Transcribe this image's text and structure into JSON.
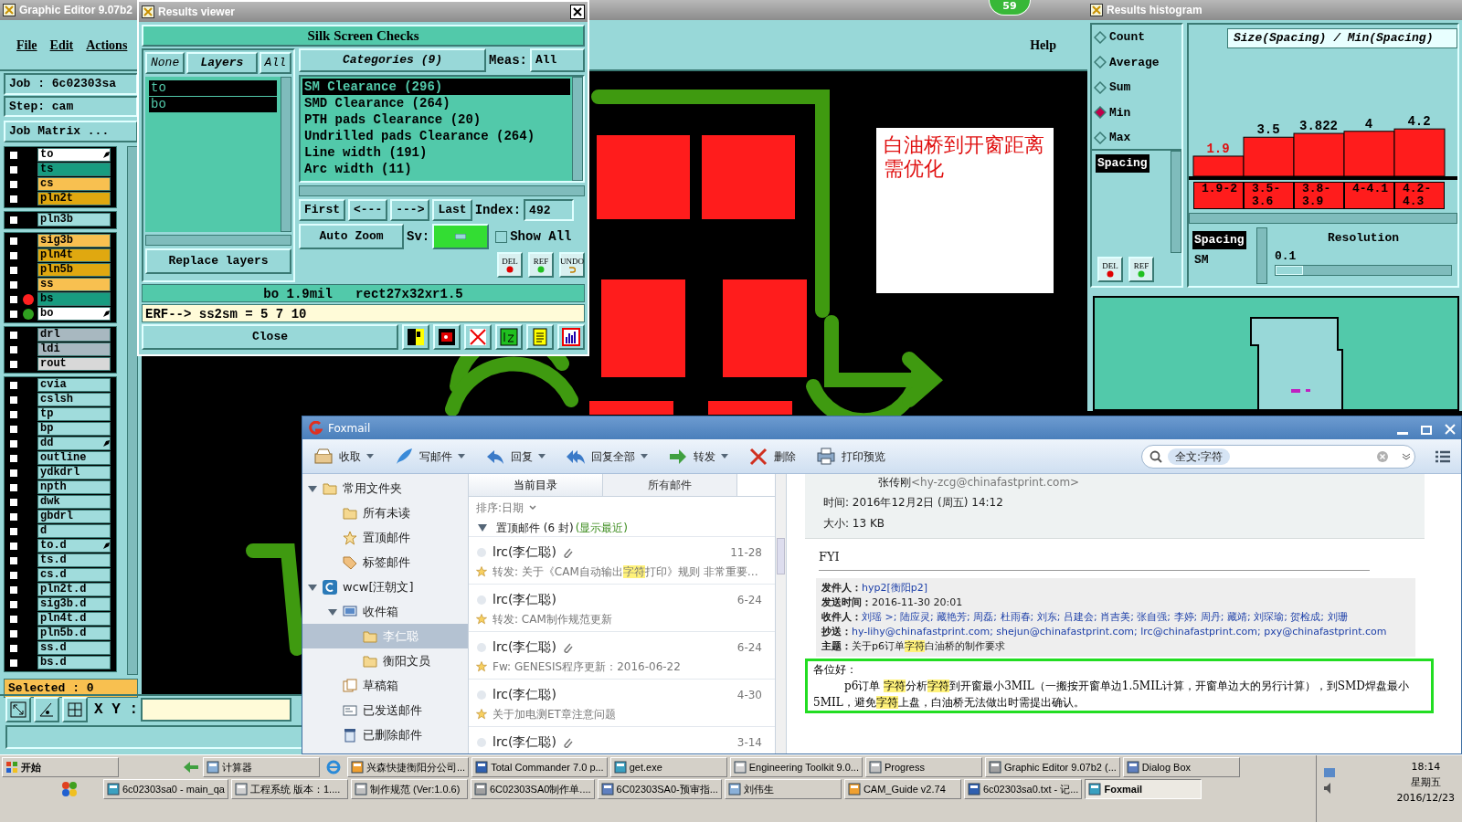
{
  "editor": {
    "title": "Graphic Editor 9.07b2",
    "menu": [
      "File",
      "Edit",
      "Actions"
    ],
    "help": "Help",
    "job": "Job : 6c02303sa",
    "step": "Step: cam",
    "job_matrix": "Job Matrix ...",
    "layer_groups": [
      [
        {
          "name": "to",
          "color": "#ffffff",
          "affected": true,
          "checked": false
        },
        {
          "name": "ts",
          "color": "#189c80",
          "affected": false,
          "checked": false
        },
        {
          "name": "cs",
          "color": "#f8c050",
          "affected": false,
          "checked": false
        },
        {
          "name": "pln2t",
          "color": "#e0a810",
          "affected": false,
          "checked": false
        }
      ],
      [
        {
          "name": "pln3b",
          "color": "#a0dcdc",
          "affected": false,
          "checked": false
        }
      ],
      [
        {
          "name": "sig3b",
          "color": "#f8c050",
          "affected": false,
          "checked": false
        },
        {
          "name": "pln4t",
          "color": "#e0a810",
          "affected": false,
          "checked": false
        },
        {
          "name": "pln5b",
          "color": "#e0a810",
          "affected": false,
          "checked": false
        },
        {
          "name": "ss",
          "color": "#f8c050",
          "affected": false,
          "checked": false
        },
        {
          "name": "bs",
          "color": "#189c80",
          "affected": false,
          "checked": false,
          "dot": {
            "color": "#ff2020"
          }
        },
        {
          "name": "bo",
          "color": "#ffffff",
          "affected": true,
          "checked": false,
          "dot": {
            "color": "#30a020"
          }
        }
      ],
      [
        {
          "name": "drl",
          "color": "#a8b8c0",
          "affected": false,
          "checked": false
        },
        {
          "name": "ldi",
          "color": "#a8b8c0",
          "affected": false,
          "checked": false
        },
        {
          "name": "rout",
          "color": "#d8d8d8",
          "affected": false,
          "checked": false
        }
      ],
      [
        {
          "name": "cvia",
          "color": "#a0dcdc",
          "affected": false,
          "checked": false
        },
        {
          "name": "cslsh",
          "color": "#a0dcdc",
          "affected": false,
          "checked": false
        },
        {
          "name": "tp",
          "color": "#a0dcdc",
          "affected": false,
          "checked": false
        },
        {
          "name": "bp",
          "color": "#a0dcdc",
          "affected": false,
          "checked": false
        },
        {
          "name": "dd",
          "color": "#a0dcdc",
          "affected": true,
          "checked": false
        },
        {
          "name": "outline",
          "color": "#a0dcdc",
          "affected": false,
          "checked": false
        },
        {
          "name": "ydkdrl",
          "color": "#a0dcdc",
          "affected": false,
          "checked": false
        },
        {
          "name": "npth",
          "color": "#a0dcdc",
          "affected": false,
          "checked": false
        },
        {
          "name": "dwk",
          "color": "#a0dcdc",
          "affected": false,
          "checked": false
        },
        {
          "name": "gbdrl",
          "color": "#a0dcdc",
          "affected": false,
          "checked": false
        },
        {
          "name": "d",
          "color": "#a0dcdc",
          "affected": false,
          "checked": false
        },
        {
          "name": "to.d",
          "color": "#a0dcdc",
          "affected": true,
          "checked": false
        },
        {
          "name": "ts.d",
          "color": "#a0dcdc",
          "affected": false,
          "checked": false
        },
        {
          "name": "cs.d",
          "color": "#a0dcdc",
          "affected": false,
          "checked": false
        },
        {
          "name": "pln2t.d",
          "color": "#a0dcdc",
          "affected": false,
          "checked": false
        },
        {
          "name": "sig3b.d",
          "color": "#a0dcdc",
          "affected": false,
          "checked": false
        },
        {
          "name": "pln4t.d",
          "color": "#a0dcdc",
          "affected": false,
          "checked": false
        },
        {
          "name": "pln5b.d",
          "color": "#a0dcdc",
          "affected": false,
          "checked": false
        },
        {
          "name": "ss.d",
          "color": "#a0dcdc",
          "affected": false,
          "checked": false
        },
        {
          "name": "bs.d",
          "color": "#a0dcdc",
          "affected": false,
          "checked": false
        }
      ]
    ],
    "selected_count": "Selected : 0",
    "xy_label": "X Y :",
    "note": "白油桥到开窗距离需优化"
  },
  "badge": "59",
  "results_viewer": {
    "title": "Results viewer",
    "heading": "Silk Screen Checks",
    "layer_buttons": [
      "None",
      "Layers",
      "All"
    ],
    "layers": [
      {
        "name": "to",
        "selected": true
      },
      {
        "name": "bo",
        "selected": true
      }
    ],
    "categories_button": "Categories (9)",
    "meas_label": "Meas:",
    "meas_value": "All",
    "categories": [
      {
        "label": "SM Clearance (296)",
        "selected": true
      },
      {
        "label": "SMD Clearance (264)",
        "selected": false
      },
      {
        "label": "PTH pads Clearance (20)",
        "selected": false
      },
      {
        "label": "Undrilled pads Clearance (264)",
        "selected": false
      },
      {
        "label": "Line width (191)",
        "selected": false
      },
      {
        "label": "Arc width (11)",
        "selected": false
      }
    ],
    "nav": [
      "First",
      "<---",
      "--->",
      "Last"
    ],
    "index_label": "Index:",
    "index_value": "492",
    "auto_zoom": "Auto Zoom",
    "sv_label": "Sv:",
    "show_all": {
      "label": "Show All",
      "checked": false
    },
    "replace": "Replace layers",
    "tools": [
      {
        "label": "DEL",
        "kind": "del"
      },
      {
        "label": "REF",
        "kind": "ref"
      },
      {
        "label": "UNDO",
        "kind": "undo"
      }
    ],
    "status": "bo 1.9mil   rect27x32xr1.5",
    "erf": "ERF--> ss2sm = 5 7 10",
    "close": "Close"
  },
  "histogram": {
    "title": "Results histogram",
    "modes": [
      {
        "label": "Count",
        "selected": false
      },
      {
        "label": "Average",
        "selected": false
      },
      {
        "label": "Sum",
        "selected": false
      },
      {
        "label": "Min",
        "selected": true
      },
      {
        "label": "Max",
        "selected": false
      }
    ],
    "attributes": [
      {
        "label": "Spacing",
        "selected": true
      }
    ],
    "buttons": [
      {
        "label": "DEL",
        "kind": "del"
      },
      {
        "label": "REF",
        "kind": "ref"
      }
    ],
    "chart_data": {
      "type": "bar",
      "title": "Size(Spacing) / Min(Spacing)",
      "categories": [
        "1.9-2",
        "3.5-3.6",
        "3.8-3.9",
        "4-4.1",
        "4.2-4.3"
      ],
      "values": [
        1.9,
        3.5,
        3.822,
        4,
        4.2
      ],
      "data_labels": true
    },
    "sub_list": [
      {
        "label": "Spacing",
        "selected": true
      },
      {
        "label": "SM",
        "selected": false
      }
    ],
    "resolution": {
      "label": "Resolution",
      "value": "0.1",
      "level": 0.0
    }
  },
  "foxmail": {
    "title": "Foxmail",
    "toolbar": [
      {
        "kind": "inbox",
        "label": "收取",
        "menu": true
      },
      {
        "kind": "compose",
        "label": "写邮件",
        "menu": true
      },
      {
        "kind": "reply",
        "label": "回复",
        "menu": true
      },
      {
        "kind": "reply_all",
        "label": "回复全部",
        "menu": true
      },
      {
        "kind": "forward",
        "label": "转发",
        "menu": true
      },
      {
        "kind": "delete",
        "label": "删除",
        "menu": false
      },
      {
        "kind": "print",
        "label": "打印预览",
        "menu": false
      }
    ],
    "search": {
      "tag": "全文:字符"
    },
    "folders": [
      {
        "label": "常用文件夹",
        "kind": "folder",
        "expanded": true,
        "selected": false,
        "children": [
          {
            "label": "所有未读",
            "kind": "folder",
            "selected": false
          },
          {
            "label": "置顶邮件",
            "kind": "star",
            "selected": false
          },
          {
            "label": "标签邮件",
            "kind": "tag",
            "selected": false
          }
        ]
      },
      {
        "label": "wcw[汪朝文]",
        "kind": "account",
        "expanded": true,
        "selected": false,
        "children": [
          {
            "label": "收件箱",
            "kind": "inbox",
            "expanded": true,
            "selected": false,
            "children": [
              {
                "label": "李仁聪",
                "kind": "folder",
                "selected": true
              },
              {
                "label": "衡阳文员",
                "kind": "folder",
                "selected": false
              }
            ]
          },
          {
            "label": "草稿箱",
            "kind": "drafts",
            "selected": false
          },
          {
            "label": "已发送邮件",
            "kind": "sent",
            "selected": false
          },
          {
            "label": "已删除邮件",
            "kind": "trash",
            "selected": false
          }
        ]
      }
    ],
    "tabs": [
      {
        "label": "当前目录",
        "selected": true
      },
      {
        "label": "所有邮件",
        "selected": false
      }
    ],
    "sort": "排序:日期",
    "group": {
      "label": "置顶邮件 (6 封)",
      "link": "(显示最近)",
      "expanded": true
    },
    "messages": [
      {
        "sender": "lrc(李仁聪)",
        "attachment": true,
        "date": "11-28",
        "subject": [
          {
            "text": "转发: 关于《CAM自动输出",
            "highlight": false
          },
          {
            "text": "字符",
            "highlight": true
          },
          {
            "text": "打印》规则 非常重要…",
            "highlight": false
          }
        ]
      },
      {
        "sender": "lrc(李仁聪)",
        "attachment": false,
        "date": "6-24",
        "subject": [
          {
            "text": "转发: CAM制作规范更新",
            "highlight": false
          }
        ]
      },
      {
        "sender": "lrc(李仁聪)",
        "attachment": true,
        "date": "6-24",
        "subject": [
          {
            "text": "Fw: GENESIS程序更新：2016-06-22",
            "highlight": false
          }
        ]
      },
      {
        "sender": "lrc(李仁聪)",
        "attachment": false,
        "date": "4-30",
        "subject": [
          {
            "text": "关于加电测ET章注意问题",
            "highlight": false
          }
        ]
      },
      {
        "sender": "lrc(李仁聪)",
        "attachment": true,
        "date": "3-14"
      }
    ],
    "reading": {
      "from_name": "张传刚",
      "from_email": "<hy-zcg@chinafastprint.com>",
      "time_label": "时间:",
      "time": "2016年12月2日 (周五) 14:12",
      "size_label": "大小:",
      "size": "13 KB",
      "fyi": "FYI",
      "quote": [
        {
          "label": "发件人：",
          "link": true,
          "segments": [
            {
              "text": "hyp2[衡阳p2]",
              "highlight": false
            }
          ]
        },
        {
          "label": "发送时间：",
          "link": false,
          "segments": [
            {
              "text": "2016-11-30 20:01",
              "highlight": false
            }
          ]
        },
        {
          "label": "收件人：",
          "link": true,
          "segments": [
            {
              "text": "刘瑶 >; 陆应灵; 藏艳芳; 周磊; 杜雨春; 刘东; 吕建会; 肖吉美; 张自强; 李婷; 周丹; 藏靖; 刘琛瑜; 贺检成; 刘珊",
              "highlight": false
            }
          ]
        },
        {
          "label": "抄送：",
          "link": true,
          "segments": [
            {
              "text": "hy-lihy@chinafastprint.com; shejun@chinafastprint.com; lrc@chinafastprint.com; pxy@chinafastprint.com",
              "highlight": false
            }
          ]
        },
        {
          "label": "主题：",
          "link": false,
          "segments": [
            {
              "text": "关于p6订单",
              "highlight": false
            },
            {
              "text": "字符",
              "highlight": true
            },
            {
              "text": "白油桥的制作要求",
              "highlight": false
            }
          ]
        }
      ],
      "greeting": "各位好：",
      "paragraph": [
        {
          "text": "p6订单 ",
          "highlight": false
        },
        {
          "text": "字符",
          "highlight": true
        },
        {
          "text": "分析",
          "highlight": false
        },
        {
          "text": "字符",
          "highlight": true
        },
        {
          "text": "到开窗最小3MIL（一搬按开窗单边1.5MIL计算，开窗单边大的另行计算），到SMD焊盘最小5MIL，避免",
          "highlight": false
        },
        {
          "text": "字符",
          "highlight": true
        },
        {
          "text": "上盘，白油桥无法做出时需提出确认。",
          "highlight": false
        }
      ]
    }
  },
  "taskbar": {
    "start": "开始",
    "row1": [
      {
        "label": "计算器",
        "selected": false
      },
      {
        "label": "兴森快捷衡阳分公司...",
        "selected": false
      },
      {
        "label": "Total Commander 7.0 p...",
        "selected": false
      },
      {
        "label": "get.exe",
        "selected": false
      },
      {
        "label": "Engineering Toolkit 9.0...",
        "selected": false
      },
      {
        "label": "Progress",
        "selected": false
      },
      {
        "label": "Graphic Editor 9.07b2 (...",
        "selected": false
      },
      {
        "label": "Dialog Box",
        "selected": false
      }
    ],
    "row2": [
      {
        "label": "6c02303sa0 - main_qa",
        "selected": false
      },
      {
        "label": "工程系统  版本：1....",
        "selected": false
      },
      {
        "label": "制作规范 (Ver:1.0.6)",
        "selected": false
      },
      {
        "label": "6C02303SA0制作单....",
        "selected": false
      },
      {
        "label": "6C02303SA0-预审指...",
        "selected": false
      },
      {
        "label": "刘伟生",
        "selected": false
      },
      {
        "label": "CAM_Guide v2.74",
        "selected": false
      },
      {
        "label": "6c02303sa0.txt - 记...",
        "selected": false
      },
      {
        "label": "Foxmail",
        "selected": true
      }
    ],
    "clock": {
      "time": "18:14",
      "weekday": "星期五",
      "date": "2016/12/23"
    }
  }
}
